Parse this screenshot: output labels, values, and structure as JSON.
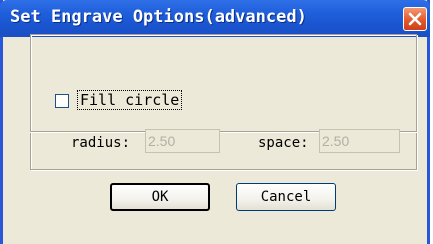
{
  "window": {
    "title": "Set Engrave Options(advanced)"
  },
  "title_bar": {
    "close_icon": "close-icon"
  },
  "fill_circle": {
    "label": "Fill circle",
    "checked": false
  },
  "radius": {
    "label": "radius:",
    "value": "2.50"
  },
  "space": {
    "label": "space:",
    "value": "2.50"
  },
  "buttons": {
    "ok": "OK",
    "cancel": "Cancel"
  },
  "colors": {
    "title_bar": "#1f5fdc",
    "close_button": "#e5582c",
    "dialog_face": "#ece9d8"
  }
}
